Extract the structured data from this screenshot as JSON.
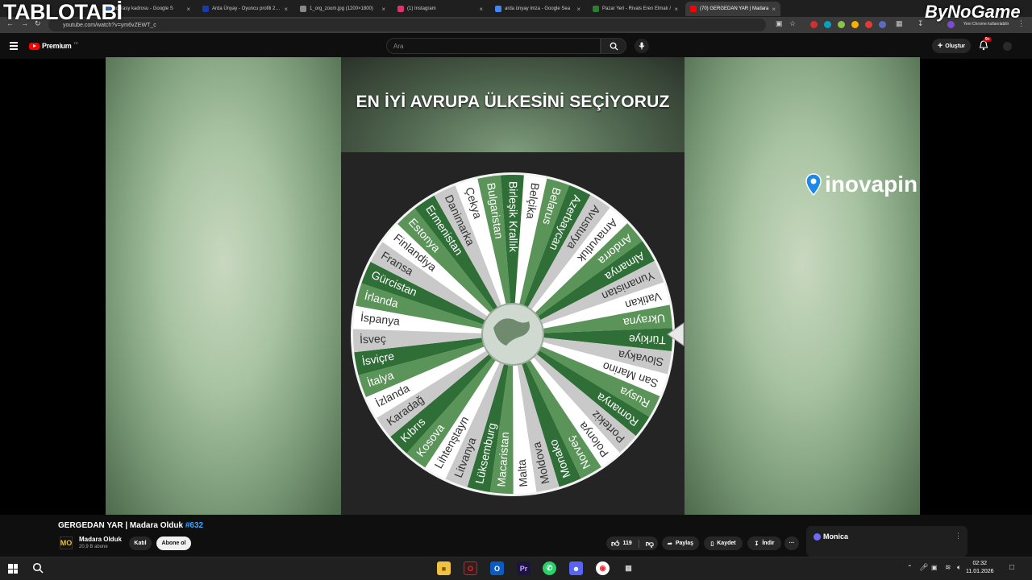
{
  "watermarks": {
    "left": "TABLOTABİ",
    "right": "ByNoGame"
  },
  "browser": {
    "tabs": [
      {
        "title": "ıcarasy kadrosu - Google S",
        "color": "#4285f4"
      },
      {
        "title": "Arda Ünyay - Oyuncu profili 2…",
        "color": "#1a3cab"
      },
      {
        "title": "1_org_zoom.jpg (1200×1800)",
        "color": "#888888"
      },
      {
        "title": "(1) Instagram",
        "color": "#e1306c"
      },
      {
        "title": "arda ünyay imza - Google Sea",
        "color": "#4285f4"
      },
      {
        "title": "Pazar Yeri - Rivals Eren Elmalı /",
        "color": "#2e7d32"
      },
      {
        "title": "(70) GERGEDAN YAR | Madara",
        "color": "#ff0000"
      }
    ],
    "url": "youtube.com/watch?v=ym6vZEWT_c",
    "chrome_update": "Yeni Chrome kullanılabilir"
  },
  "youtube": {
    "logo": "Premium",
    "logo_badge": "TR",
    "search_placeholder": "Ara",
    "create_label": "Oluştur",
    "notif_count": "9+"
  },
  "video": {
    "title_overlay": "EN İYİ AVRUPA ÜLKESİNİ SEÇİYORUZ",
    "sponsor": "inovapin",
    "wheel_countries": [
      "Belçika",
      "Belarus",
      "Azerbaycan",
      "Avusturya",
      "Arnavutluk",
      "Andorra",
      "Almanya",
      "Yunanistan",
      "Vatikan",
      "Ukrayna",
      "Türkiye",
      "Slovakya",
      "San Marino",
      "Rusya",
      "Romanya",
      "Portekiz",
      "Polonya",
      "Norveç",
      "Monako",
      "Moldova",
      "Malta",
      "Macaristan",
      "Lüksemburg",
      "Litvanya",
      "Lihtenştayn",
      "Kosova",
      "Kıbrıs",
      "Karadağ",
      "İzlanda",
      "İtalya",
      "İsviçre",
      "İsveç",
      "İspanya",
      "İrlanda",
      "Gürcistan",
      "Fransa",
      "Finlandiya",
      "Estonya",
      "Ermenistan",
      "Danimarka",
      "Çekya",
      "Bulgaristan",
      "Birleşik Krallık"
    ]
  },
  "details": {
    "title": "GERGEDAN YAR | Madara Olduk",
    "hashtag": "#632",
    "channel": "Madara Olduk",
    "channel_initials": "MO",
    "subscribers": "20,9 B abone",
    "join_label": "Katıl",
    "subscribe_label": "Abone ol",
    "likes": "119",
    "share_label": "Paylaş",
    "save_label": "Kaydet",
    "download_label": "İndir",
    "monica_label": "Monica"
  },
  "taskbar": {
    "time": "02:32",
    "date": "11.01.2026"
  }
}
